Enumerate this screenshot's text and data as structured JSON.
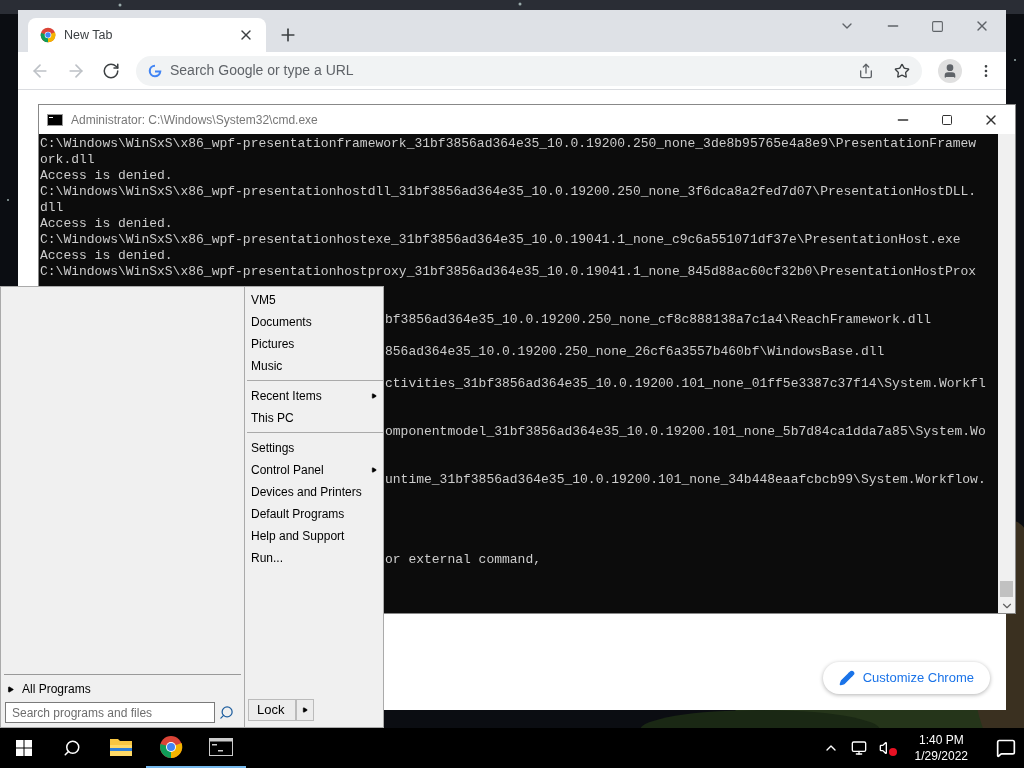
{
  "browser": {
    "tabs": [
      {
        "label": "New Tab",
        "selected": true
      }
    ],
    "address_bar": {
      "placeholder": "Search Google or type a URL"
    },
    "customize_button": "Customize Chrome"
  },
  "console_window": {
    "title": "Administrator: C:\\Windows\\System32\\cmd.exe",
    "lines": [
      {
        "kind": "text",
        "text": "C:\\Windows\\WinSxS\\x86_wpf-presentationframework_31bf3856ad364e35_10.0.19200.250_none_3de8b95765e4a8e9\\PresentationFramew"
      },
      {
        "kind": "text",
        "text": "ork.dll"
      },
      {
        "kind": "text",
        "text": "Access is denied."
      },
      {
        "kind": "text",
        "text": "C:\\Windows\\WinSxS\\x86_wpf-presentationhostdll_31bf3856ad364e35_10.0.19200.250_none_3f6dca8a2fed7d07\\PresentationHostDLL."
      },
      {
        "kind": "text",
        "text": "dll"
      },
      {
        "kind": "text",
        "text": "Access is denied."
      },
      {
        "kind": "text",
        "text": "C:\\Windows\\WinSxS\\x86_wpf-presentationhostexe_31bf3856ad364e35_10.0.19041.1_none_c9c6a551071df37e\\PresentationHost.exe"
      },
      {
        "kind": "text",
        "text": "Access is denied."
      },
      {
        "kind": "text",
        "text": "C:\\Windows\\WinSxS\\x86_wpf-presentationhostproxy_31bf3856ad364e35_10.0.19041.1_none_845d88ac60cf32b0\\PresentationHostProx"
      },
      {
        "kind": "hidden"
      },
      {
        "kind": "hidden"
      },
      {
        "kind": "covered",
        "text": "bf3856ad364e35_10.0.19200.250_none_cf8c888138a7c1a4\\ReachFramework.dll"
      },
      {
        "kind": "hidden"
      },
      {
        "kind": "covered",
        "text": "856ad364e35_10.0.19200.250_none_26cf6a3557b460bf\\WindowsBase.dll"
      },
      {
        "kind": "hidden"
      },
      {
        "kind": "covered",
        "text": "ctivities_31bf3856ad364e35_10.0.19200.101_none_01ff5e3387c37f14\\System.Workfl"
      },
      {
        "kind": "hidden"
      },
      {
        "kind": "hidden"
      },
      {
        "kind": "covered",
        "text": "omponentmodel_31bf3856ad364e35_10.0.19200.101_none_5b7d84ca1dda7a85\\System.Wo"
      },
      {
        "kind": "hidden"
      },
      {
        "kind": "hidden"
      },
      {
        "kind": "covered",
        "text": "untime_31bf3856ad364e35_10.0.19200.101_none_34b448eaafcbcb99\\System.Workflow."
      },
      {
        "kind": "hidden"
      },
      {
        "kind": "hidden"
      },
      {
        "kind": "hidden"
      },
      {
        "kind": "hidden"
      },
      {
        "kind": "covered",
        "text": "or external command,"
      }
    ]
  },
  "start_menu": {
    "places": [
      {
        "label": "VM5",
        "submenu": false,
        "divider_after": false
      },
      {
        "label": "Documents",
        "submenu": false,
        "divider_after": false
      },
      {
        "label": "Pictures",
        "submenu": false,
        "divider_after": false
      },
      {
        "label": "Music",
        "submenu": false,
        "divider_after": true
      },
      {
        "label": "Recent Items",
        "submenu": true,
        "divider_after": false
      },
      {
        "label": "This PC",
        "submenu": false,
        "divider_after": true
      },
      {
        "label": "Settings",
        "submenu": false,
        "divider_after": false
      },
      {
        "label": "Control Panel",
        "submenu": true,
        "divider_after": false
      },
      {
        "label": "Devices and Printers",
        "submenu": false,
        "divider_after": false
      },
      {
        "label": "Default Programs",
        "submenu": false,
        "divider_after": false
      },
      {
        "label": "Help and Support",
        "submenu": false,
        "divider_after": false
      },
      {
        "label": "Run...",
        "submenu": false,
        "divider_after": false
      }
    ],
    "all_programs": "All Programs",
    "search": {
      "placeholder": "Search programs and files"
    },
    "lock_button": "Lock"
  },
  "taskbar": {
    "apps": [
      {
        "kind": "explorer",
        "running": false
      },
      {
        "kind": "chrome",
        "running": true
      },
      {
        "kind": "console",
        "running": true
      }
    ],
    "time": "1:40 PM",
    "date": "1/29/2022"
  }
}
